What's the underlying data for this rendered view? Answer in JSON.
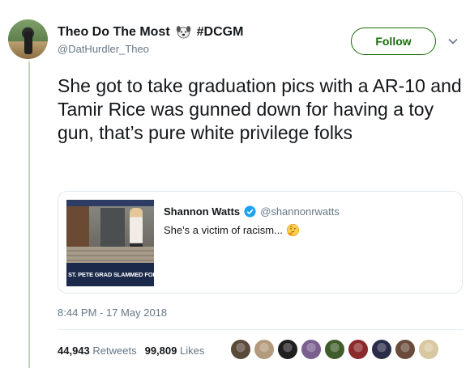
{
  "author": {
    "display_name": "Theo Do The Most",
    "emoji": "dog-face-icon",
    "tag": "#DCGM",
    "handle": "@DatHurdler_Theo"
  },
  "follow_button_label": "Follow",
  "tweet_text": "She got to take graduation pics with a AR-10 and Tamir Rice was gunned down for having a toy gun, that’s pure white privilege folks",
  "quote": {
    "display_name": "Shannon Watts",
    "verified": true,
    "handle": "@shannonrwatts",
    "text": "She's a victim of racism...",
    "emoji": "thinking-face-icon",
    "media_banner_headline": "ST. PETE GRAD SLAMMED FOR PHOTOS"
  },
  "timestamp": "8:44 PM - 17 May 2018",
  "stats": {
    "retweets_count": "44,943",
    "retweets_label": "Retweets",
    "likes_count": "99,809",
    "likes_label": "Likes"
  },
  "liker_colors": [
    "#5a4a3a",
    "#b39a7c",
    "#1f1f1f",
    "#7a5f8f",
    "#3f5d2a",
    "#8a2a2a",
    "#2b2b4a",
    "#6b4b3b",
    "#d8c7a0"
  ],
  "colors": {
    "follow_green": "#1a6e0a",
    "thread_line": "#c4d6b8",
    "verified_blue": "#1da1f2",
    "muted_text": "#657786"
  }
}
